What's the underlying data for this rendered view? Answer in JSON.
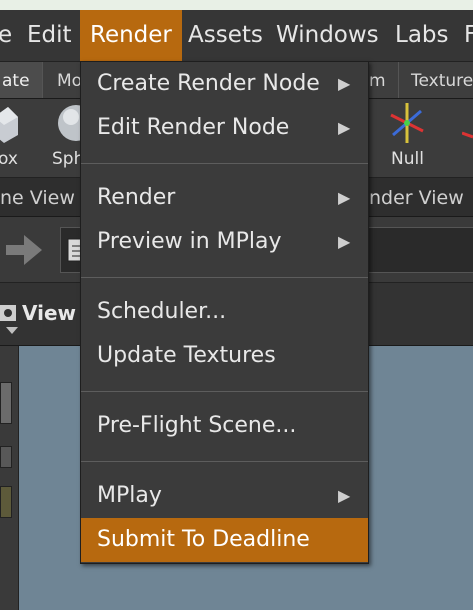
{
  "menubar": {
    "items": [
      "e",
      "Edit",
      "Render",
      "Assets",
      "Windows",
      "Labs",
      "F"
    ],
    "active_index": 2
  },
  "shelf_tabs": [
    "ate",
    "Mo",
    "m",
    "Texture"
  ],
  "tools": {
    "labels": [
      "ox",
      "Sph",
      "Null"
    ]
  },
  "view_tabs": [
    "ne View",
    "nder View"
  ],
  "view_header": {
    "title": "View"
  },
  "dropdown": {
    "items": [
      {
        "label": "Create Render Node",
        "submenu": true
      },
      {
        "label": "Edit Render Node",
        "submenu": true
      },
      {
        "label": "Render",
        "submenu": true
      },
      {
        "label": "Preview in MPlay",
        "submenu": true
      },
      {
        "label": "Scheduler..."
      },
      {
        "label": "Update Textures"
      },
      {
        "label": "Pre-Flight Scene..."
      },
      {
        "label": "MPlay",
        "submenu": true
      },
      {
        "label": "Submit To Deadline",
        "highlighted": true
      }
    ],
    "submenu_glyph": "▶"
  },
  "colors": {
    "accent": "#b7690f",
    "menu_bg": "#3b3b3b",
    "viewport_bg": "#6f8595"
  }
}
